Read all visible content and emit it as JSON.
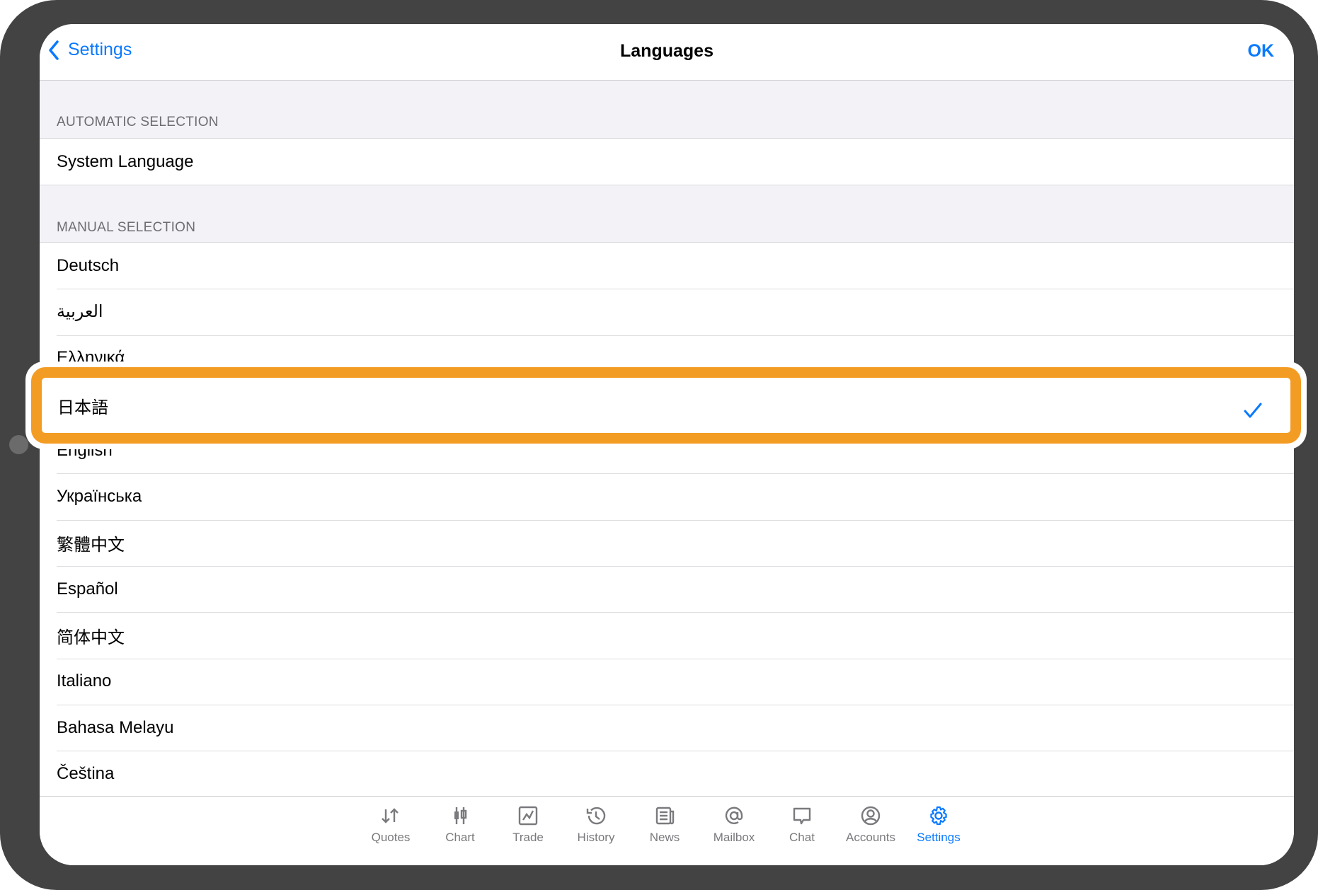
{
  "nav": {
    "back_label": "Settings",
    "title": "Languages",
    "ok_label": "OK"
  },
  "automatic": {
    "header": "AUTOMATIC SELECTION",
    "items": [
      "System Language"
    ]
  },
  "manual": {
    "header": "MANUAL SELECTION",
    "items": [
      "Deutsch",
      "العربية",
      "Ελληνικά",
      "日本語",
      "English",
      "Українська",
      "繁體中文",
      "Español",
      "简体中文",
      "Italiano",
      "Bahasa Melayu",
      "Čeština"
    ],
    "selected": "日本語"
  },
  "highlight": {
    "label": "日本語",
    "icon": "checkmark-icon",
    "border_color": "#f39c24"
  },
  "tabs": [
    {
      "label": "Quotes",
      "icon": "quotes-icon"
    },
    {
      "label": "Chart",
      "icon": "candlestick-icon"
    },
    {
      "label": "Trade",
      "icon": "trade-icon"
    },
    {
      "label": "History",
      "icon": "history-icon"
    },
    {
      "label": "News",
      "icon": "news-icon"
    },
    {
      "label": "Mailbox",
      "icon": "at-sign-icon"
    },
    {
      "label": "Chat",
      "icon": "chat-icon"
    },
    {
      "label": "Accounts",
      "icon": "account-icon"
    },
    {
      "label": "Settings",
      "icon": "gear-icon",
      "active": true
    }
  ],
  "colors": {
    "accent": "#0a7aff",
    "highlight": "#f39c24",
    "frame": "#434343"
  }
}
